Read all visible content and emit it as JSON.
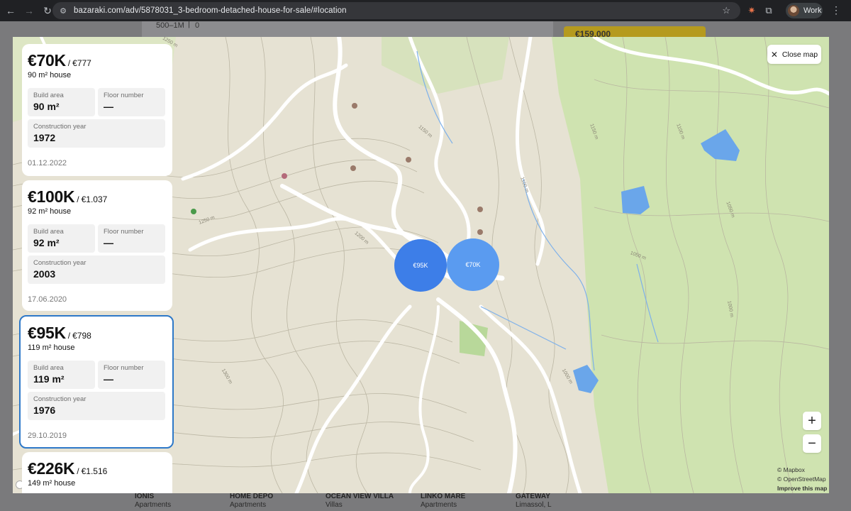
{
  "browser": {
    "url": "bazaraki.com/adv/5878031_3-bedroom-detached-house-for-sale/#location",
    "profile_name": "Work"
  },
  "page_background": {
    "price_range_label": "500–1M",
    "price_range_value": "0",
    "listing_price": "€159,000",
    "bottom_cards": [
      {
        "title": "IONIS",
        "subtitle": "Apartments"
      },
      {
        "title": "HOME DEPO",
        "subtitle": "Apartments"
      },
      {
        "title": "OCEAN VIEW VILLA",
        "subtitle": "Villas"
      },
      {
        "title": "LINKO MARE",
        "subtitle": "Apartments"
      },
      {
        "title": "GATEWAY",
        "subtitle": "Limassol, L"
      }
    ]
  },
  "map": {
    "close_label": "Close map",
    "clusters": [
      {
        "label": "€95K"
      },
      {
        "label": "€70K"
      }
    ],
    "zoom_in": "+",
    "zoom_out": "−",
    "attribution": {
      "mapbox": "© Mapbox",
      "osm": "© OpenStreetMap",
      "improve": "Improve this map"
    },
    "contour_labels": [
      "1250 m",
      "1250 m",
      "1200 m",
      "1150 m",
      "1100 m",
      "1050 m",
      "1000 m",
      "1150 m",
      "1100 m",
      "1050 m",
      "1000 m",
      "1300 m"
    ]
  },
  "listings": [
    {
      "price": "€70K",
      "per_sqm": "€777",
      "subtitle": "90 m² house",
      "build_area_label": "Build area",
      "build_area": "90 m²",
      "floor_label": "Floor number",
      "floor": "—",
      "year_label": "Construction year",
      "year": "1972",
      "date": "01.12.2022"
    },
    {
      "price": "€100K",
      "per_sqm": "€1.037",
      "subtitle": "92 m² house",
      "build_area_label": "Build area",
      "build_area": "92 m²",
      "floor_label": "Floor number",
      "floor": "—",
      "year_label": "Construction year",
      "year": "2003",
      "date": "17.06.2020"
    },
    {
      "price": "€95K",
      "per_sqm": "€798",
      "subtitle": "119 m² house",
      "build_area_label": "Build area",
      "build_area": "119 m²",
      "floor_label": "Floor number",
      "floor": "—",
      "year_label": "Construction year",
      "year": "1976",
      "date": "29.10.2019"
    },
    {
      "price": "€226K",
      "per_sqm": "€1.516",
      "subtitle": "149 m² house"
    }
  ],
  "colors": {
    "accent": "#2d78c8",
    "cluster_primary": "#3d7ee8",
    "cluster_secondary": "#5a9bf0",
    "forest": "#cfe3b0",
    "water": "#6aa6ea"
  }
}
